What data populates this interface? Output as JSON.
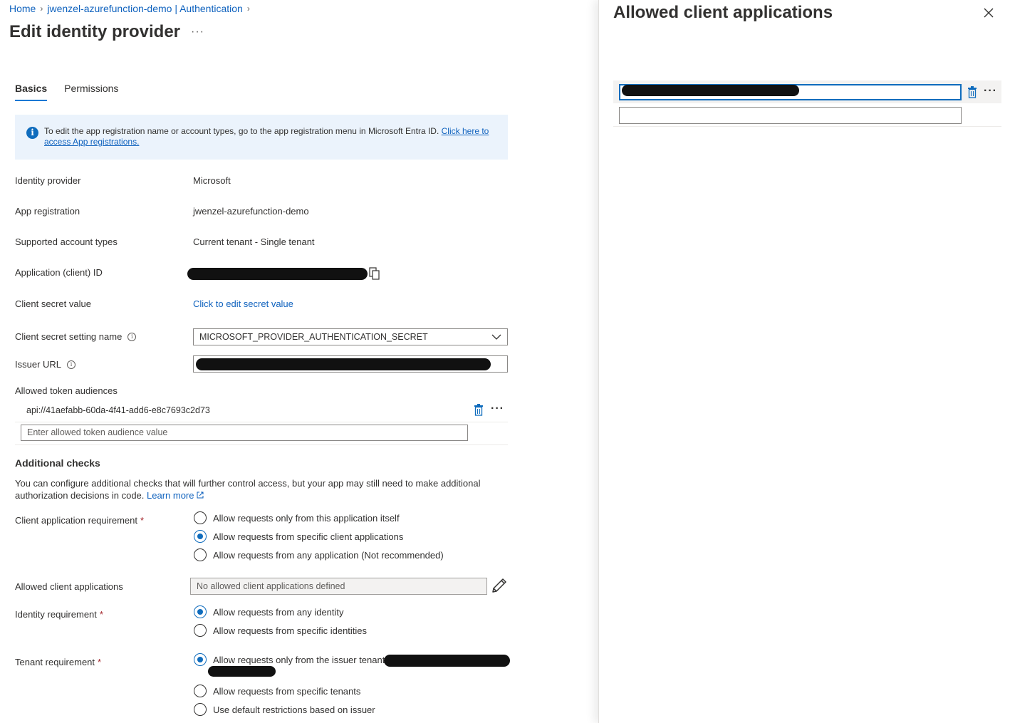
{
  "breadcrumb": {
    "home": "Home",
    "resource": "jwenzel-azurefunction-demo | Authentication",
    "separator": ">"
  },
  "page": {
    "title": "Edit identity provider",
    "more": "···"
  },
  "tabs": [
    {
      "label": "Basics",
      "active": true
    },
    {
      "label": "Permissions",
      "active": false
    }
  ],
  "info": {
    "icon": "info-icon",
    "text": "To edit the app registration name or account types, go to the app registration menu in Microsoft Entra ID. ",
    "link": "Click here to access App registrations."
  },
  "fields": {
    "identity_provider": {
      "label": "Identity provider",
      "value": "Microsoft"
    },
    "app_registration": {
      "label": "App registration",
      "value": "jwenzel-azurefunction-demo"
    },
    "account_types": {
      "label": "Supported account types",
      "value": "Current tenant - Single tenant"
    },
    "client_id": {
      "label": "Application (client) ID"
    },
    "client_secret": {
      "label": "Client secret value",
      "value": "Click to edit secret value"
    },
    "secret_setting": {
      "label": "Client secret setting name",
      "value": "MICROSOFT_PROVIDER_AUTHENTICATION_SECRET"
    },
    "issuer_url": {
      "label": "Issuer URL"
    }
  },
  "audiences": {
    "label": "Allowed token audiences",
    "items": [
      "api://41aefabb-60da-4f41-add6-e8c7693c2d73"
    ],
    "placeholder": "Enter allowed token audience value"
  },
  "additional_checks": {
    "title": "Additional checks",
    "description": "You can configure additional checks that will further control access, but your app may still need to make additional authorization decisions in code. ",
    "learn_more": "Learn more"
  },
  "client_app_requirement": {
    "label": "Client application requirement",
    "required_mark": "*",
    "options": [
      {
        "label": "Allow requests only from this application itself",
        "checked": false
      },
      {
        "label": "Allow requests from specific client applications",
        "checked": true
      },
      {
        "label": "Allow requests from any application (Not recommended)",
        "checked": false
      }
    ]
  },
  "allowed_clients": {
    "label": "Allowed client applications",
    "value": "No allowed client applications defined",
    "edit_icon": "pencil-icon"
  },
  "identity_requirement": {
    "label": "Identity requirement",
    "required_mark": "*",
    "options": [
      {
        "label": "Allow requests from any identity",
        "checked": true
      },
      {
        "label": "Allow requests from specific identities",
        "checked": false
      }
    ]
  },
  "tenant_requirement": {
    "label": "Tenant requirement",
    "required_mark": "*",
    "options": [
      {
        "label": "Allow requests only from the issuer tenant",
        "checked": true
      },
      {
        "label": "Allow requests from specific tenants",
        "checked": false
      },
      {
        "label": "Use default restrictions based on issuer",
        "checked": false
      }
    ]
  },
  "panel": {
    "title": "Allowed client applications",
    "close_icon": "close-icon"
  },
  "colors": {
    "accent": "#0f6cbd",
    "link": "#0f62be",
    "info_bg": "#ebf3fc",
    "required": "#a4262c"
  }
}
